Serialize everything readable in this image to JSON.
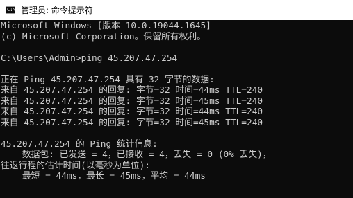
{
  "window": {
    "title": "管理员: 命令提示符",
    "icon": "cmd-icon",
    "icon_glyph": "C:\\"
  },
  "console": {
    "lines": [
      "Microsoft Windows [版本 10.0.19044.1645]",
      "(c) Microsoft Corporation。保留所有权利。",
      "",
      "C:\\Users\\Admin>ping 45.207.47.254",
      "",
      "正在 Ping 45.207.47.254 具有 32 字节的数据:",
      "来自 45.207.47.254 的回复: 字节=32 时间=44ms TTL=240",
      "来自 45.207.47.254 的回复: 字节=32 时间=45ms TTL=240",
      "来自 45.207.47.254 的回复: 字节=32 时间=44ms TTL=240",
      "来自 45.207.47.254 的回复: 字节=32 时间=45ms TTL=240",
      "",
      "45.207.47.254 的 Ping 统计信息:",
      "    数据包: 已发送 = 4，已接收 = 4，丢失 = 0 (0% 丢失)，",
      "往返行程的估计时间(以毫秒为单位):",
      "    最短 = 44ms，最长 = 45ms，平均 = 44ms"
    ]
  },
  "colors": {
    "console_background": "#0c0c0c",
    "console_text": "#cccccc",
    "titlebar_background": "#ffffff"
  }
}
